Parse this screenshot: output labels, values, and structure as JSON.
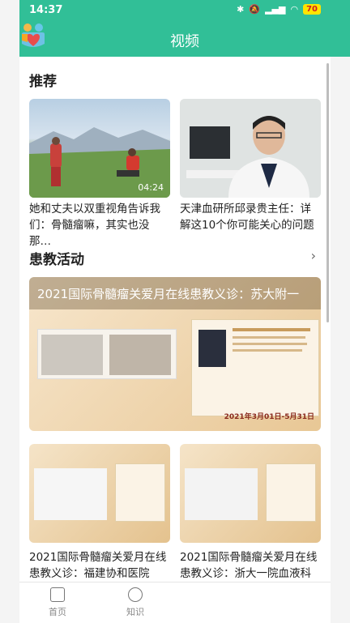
{
  "status": {
    "time": "14:37",
    "battery": "70"
  },
  "header": {
    "title": "视频"
  },
  "recommend": {
    "title": "推荐",
    "items": [
      {
        "caption": "她和丈夫以双重视角告诉我们：骨髓瘤嘛，其实也没那…",
        "duration": "04:24"
      },
      {
        "caption": "天津血研所邱录贵主任：详解这10个你可能关心的问题",
        "duration": ""
      }
    ]
  },
  "activity": {
    "title": "患教活动",
    "banner_title": "2021国际骨髓瘤关爱月在线患教义诊：苏大附一",
    "banner_date": "2021年3月01日-5月31日",
    "items": [
      {
        "caption": "2021国际骨髓瘤关爱月在线患教义诊：福建协和医院"
      },
      {
        "caption": "2021国际骨髓瘤关爱月在线患教义诊：浙大一院血液科"
      }
    ]
  },
  "nav": {
    "home": "首页",
    "knowledge": "知识"
  },
  "colors": {
    "brand": "#31bf97"
  }
}
